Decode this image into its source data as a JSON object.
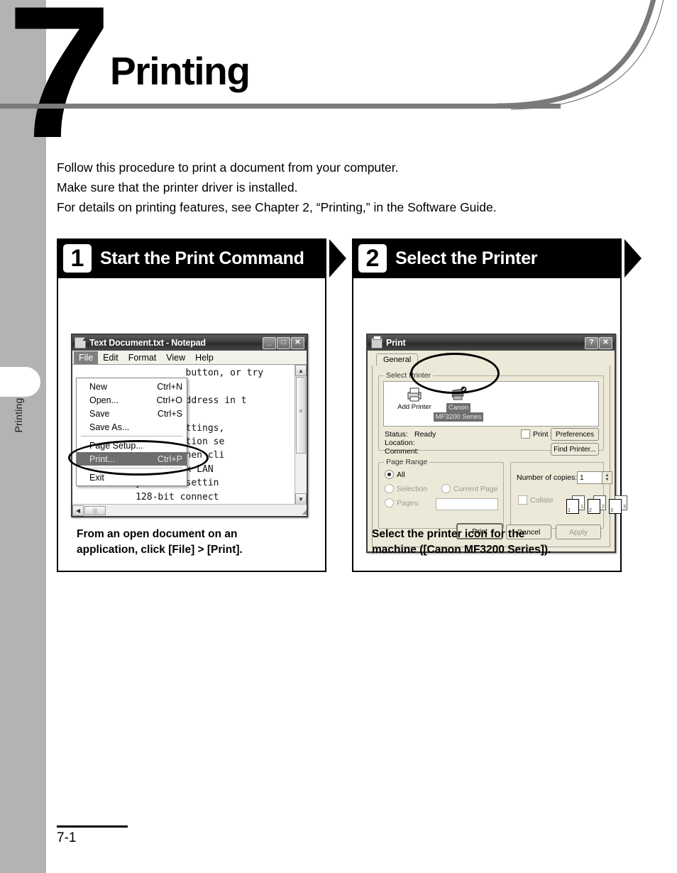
{
  "chapter": {
    "number": "7",
    "title": "Printing",
    "side_tab_label": "Printing"
  },
  "intro": {
    "line1": "Follow this procedure to print a document from your computer.",
    "line2": "Make sure that the printer driver is installed.",
    "line3": "For details on printing features, see Chapter 2, “Printing,” in the Software Guide."
  },
  "steps": [
    {
      "badge": "1",
      "heading": "Start the Print Command",
      "caption_line1": "From an open document on an",
      "caption_line2": "application, click [File] > [Print]."
    },
    {
      "badge": "2",
      "heading": "Select the Printer",
      "caption_line1": "Select the printer icon for the",
      "caption_line2": "machine ([Canon MF3200 Series])."
    }
  ],
  "notepad": {
    "title": "Text Document.txt - Notepad",
    "minimize": "_",
    "maximize": "□",
    "close": "✕",
    "menubar": [
      "File",
      "Edit",
      "Format",
      "View",
      "Help"
    ],
    "file_menu": [
      {
        "label": "New",
        "accel": "Ctrl+N",
        "selected": false
      },
      {
        "label": "Open...",
        "accel": "Ctrl+O",
        "selected": false
      },
      {
        "label": "Save",
        "accel": "Ctrl+S",
        "selected": false
      },
      {
        "label": "Save As...",
        "accel": "",
        "selected": false
      },
      {
        "separator": true
      },
      {
        "label": "Page Setup...",
        "accel": "",
        "selected": false
      },
      {
        "label": "Print...",
        "accel": "Ctrl+P",
        "selected": true
      },
      {
        "separator": true
      },
      {
        "label": "Exit",
        "accel": "",
        "selected": false
      }
    ],
    "document_text": "                    button, or try\n\n               age address in t\n\n           ection settings,\n           et connection se\n           nu, and then cli\n           tab, click LAN\n           y detect settin\n           128-bit connect\n           to reach a secur\nClick the  Back button to try anot",
    "scroll_up": "▲",
    "scroll_down": "▼",
    "scroll_left": "◀",
    "scroll_right": "▶"
  },
  "print_dialog": {
    "title": "Print",
    "help_btn": "?",
    "close_btn": "✕",
    "tab": "General",
    "select_printer_group": "Select Printer",
    "printers": [
      {
        "name_line1": "Add Printer",
        "name_line2": "",
        "selected": false
      },
      {
        "name_line1": "Canon",
        "name_line2": "MF3200 Series",
        "selected": true
      }
    ],
    "status_label": "Status:",
    "status_value": "Ready",
    "location_label": "Location:",
    "location_value": "",
    "comment_label": "Comment:",
    "comment_value": "",
    "print_to_file": "Print to file",
    "preferences_btn": "Preferences",
    "find_printer_btn": "Find Printer...",
    "page_range_group": "Page Range",
    "range_all": "All",
    "range_selection": "Selection",
    "range_current_page": "Current Page",
    "range_pages": "Pages:",
    "pages_value": "",
    "copies_label": "Number of copies:",
    "copies_value": "1",
    "spin_up": "▲",
    "spin_down": "▼",
    "collate_label": "Collate",
    "collate_pages": [
      "1",
      "2",
      "3"
    ],
    "print_btn": "Print",
    "cancel_btn": "Cancel",
    "apply_btn": "Apply"
  },
  "footer": {
    "page_number": "7-1"
  }
}
